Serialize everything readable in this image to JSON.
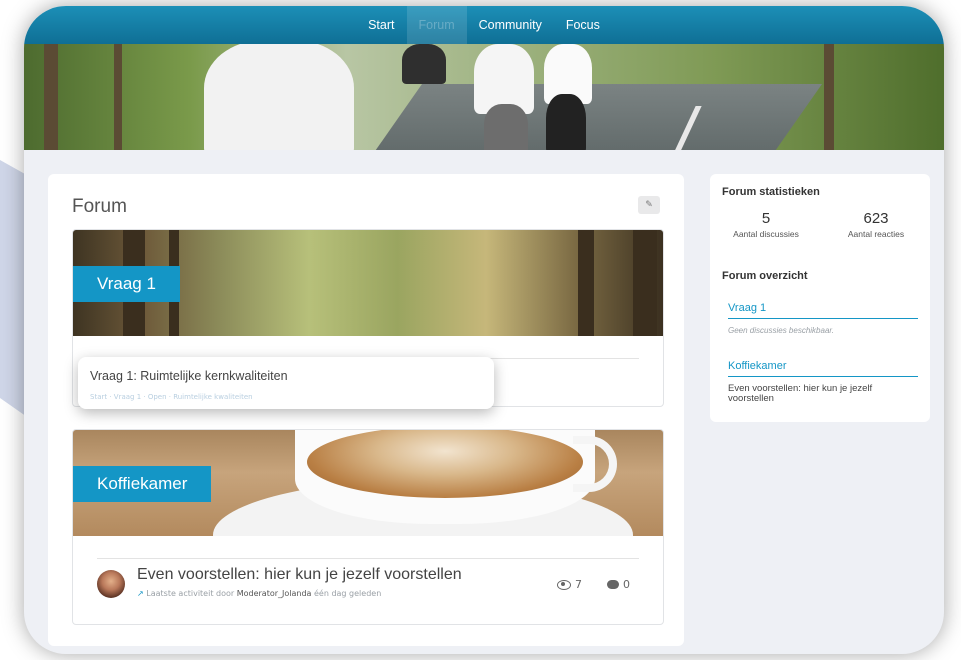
{
  "nav": {
    "items": [
      "Start",
      "Forum",
      "Community",
      "Focus"
    ],
    "active": "Forum"
  },
  "forum": {
    "title": "Forum",
    "edit_icon": "pencil-icon",
    "categories": [
      {
        "label": "Vraag 1",
        "discussion": {
          "title": "Vraag 1: Ruimtelijke kernkwaliteiten",
          "meta": "Start · Vraag 1 · Open · Ruimtelijke kwaliteiten"
        }
      },
      {
        "label": "Koffiekamer",
        "discussion": {
          "title": "Even voorstellen: hier kun je jezelf voorstellen",
          "meta_prefix": "Laatste activiteit door ",
          "moderator": "Moderator_Jolanda",
          "meta_suffix": " één dag geleden",
          "views": "7",
          "replies": "0"
        }
      }
    ]
  },
  "sidebar": {
    "stats_title": "Forum statistieken",
    "discussions_count": "5",
    "discussions_label": "Aantal discussies",
    "reactions_count": "623",
    "reactions_label": "Aantal reacties",
    "overview_title": "Forum overzicht",
    "overview": [
      {
        "label": "Vraag 1",
        "note": "Geen discussies beschikbaar."
      },
      {
        "label": "Koffiekamer",
        "desc": "Even voorstellen: hier kun je jezelf voorstellen"
      }
    ]
  },
  "colors": {
    "accent": "#1496c6",
    "navbar": "#12789f"
  }
}
